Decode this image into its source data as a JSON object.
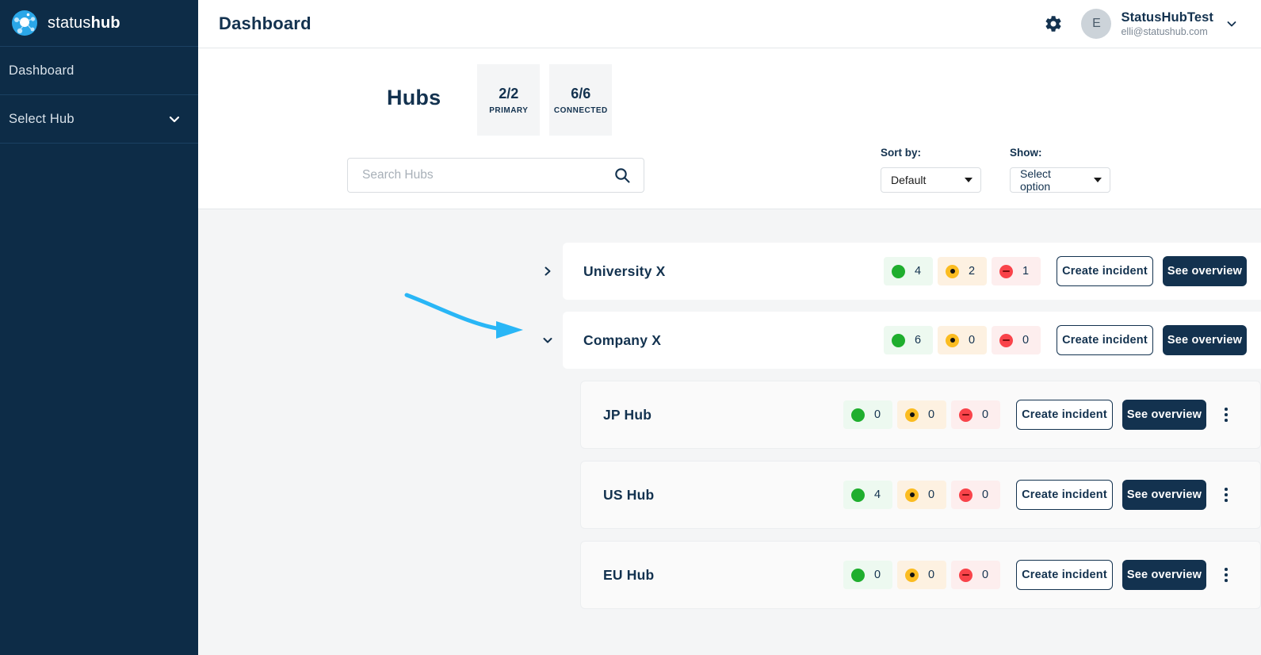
{
  "sidebar": {
    "brand": {
      "light": "status",
      "bold": "hub",
      "logo_icon": "statushub-logo-icon"
    },
    "items": [
      {
        "label": "Dashboard"
      },
      {
        "label": "Select Hub",
        "icon": "chevron-down-icon"
      }
    ]
  },
  "topbar": {
    "title": "Dashboard",
    "gear_icon": "gear-icon",
    "user": {
      "avatar_initial": "E",
      "name": "StatusHubTest",
      "email": "elli@statushub.com",
      "caret_icon": "chevron-down-icon"
    }
  },
  "hubs": {
    "title": "Hubs",
    "stats": [
      {
        "value": "2/2",
        "label": "PRIMARY"
      },
      {
        "value": "6/6",
        "label": "CONNECTED"
      }
    ],
    "search": {
      "placeholder": "Search Hubs",
      "value": "",
      "icon": "search-icon"
    },
    "filters": [
      {
        "label": "Sort by:",
        "value": "Default"
      },
      {
        "label": "Show:",
        "value": "Select option"
      }
    ]
  },
  "buttons": {
    "create_incident": "Create incident",
    "see_overview": "See overview",
    "kebab_icon": "more-vertical-icon",
    "go_icon": "chevron-right-icon",
    "expand_icon": "chevron-right-icon",
    "collapse_icon": "chevron-down-icon"
  },
  "colors": {
    "sidebar_bg": "#0d2c47",
    "navy": "#13324f",
    "status_ok": "#1fae2e",
    "status_warn": "#fbbc21",
    "status_error": "#f9434a",
    "annotation_arrow": "#29b6f6",
    "content_bg": "#f4f5f6"
  },
  "rows": [
    {
      "name": "University X",
      "type": "parent",
      "expanded": false,
      "counts": {
        "ok": "4",
        "warn": "2",
        "error": "1"
      }
    },
    {
      "name": "Company X",
      "type": "parent",
      "expanded": true,
      "counts": {
        "ok": "6",
        "warn": "0",
        "error": "0"
      }
    },
    {
      "name": "JP Hub",
      "type": "child",
      "counts": {
        "ok": "0",
        "warn": "0",
        "error": "0"
      }
    },
    {
      "name": "US Hub",
      "type": "child",
      "counts": {
        "ok": "4",
        "warn": "0",
        "error": "0"
      }
    },
    {
      "name": "EU Hub",
      "type": "child",
      "counts": {
        "ok": "0",
        "warn": "0",
        "error": "0"
      }
    }
  ],
  "annotation": {
    "type": "curved-arrow",
    "points_to": "Company X expand toggle"
  }
}
